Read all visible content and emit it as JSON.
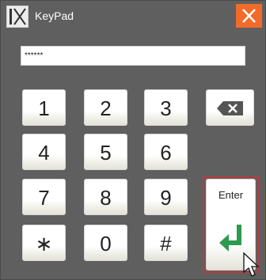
{
  "window": {
    "title": "KeyPad",
    "logo_icon": "ix-logo-icon",
    "close_icon": "close-icon",
    "close_color": "#f26b2a"
  },
  "display": {
    "value": "******"
  },
  "keys": {
    "k1": "1",
    "k2": "2",
    "k3": "3",
    "k4": "4",
    "k5": "5",
    "k6": "6",
    "k7": "7",
    "k8": "8",
    "k9": "9",
    "star": "∗",
    "k0": "0",
    "hash": "#"
  },
  "backspace": {
    "icon": "backspace-icon"
  },
  "enter": {
    "label": "Enter",
    "icon": "enter-arrow-icon",
    "arrow_color": "#2e9a4e",
    "highlight_color": "#b83b3b"
  },
  "cursor": {
    "icon": "mouse-pointer-icon"
  }
}
